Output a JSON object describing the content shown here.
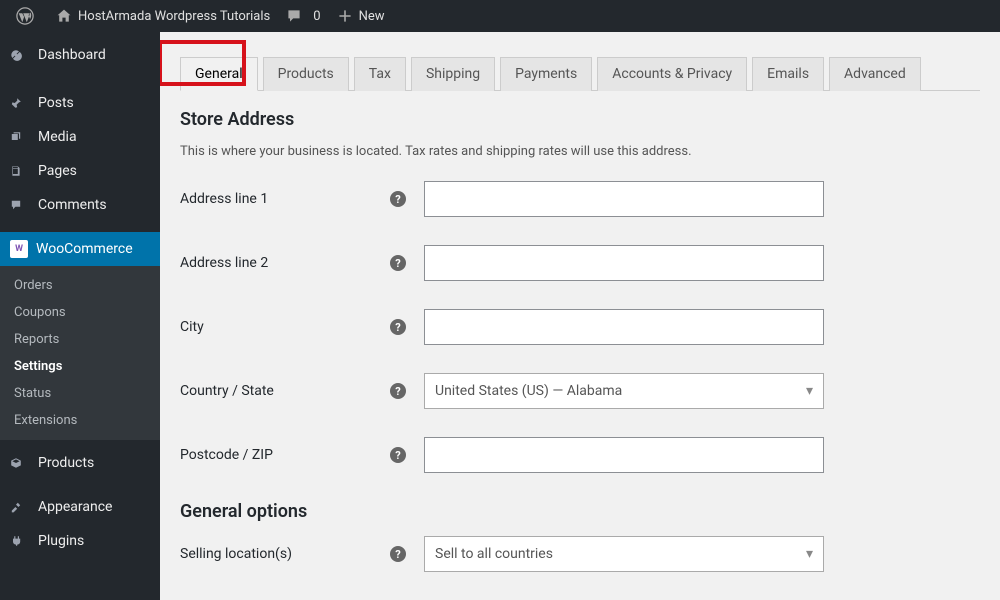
{
  "adminbar": {
    "site_title": "HostArmada Wordpress Tutorials",
    "comments_count": "0",
    "new_label": "New"
  },
  "sidebar": {
    "items": [
      {
        "label": "Dashboard"
      },
      {
        "label": "Posts"
      },
      {
        "label": "Media"
      },
      {
        "label": "Pages"
      },
      {
        "label": "Comments"
      },
      {
        "label": "WooCommerce"
      },
      {
        "label": "Products"
      },
      {
        "label": "Appearance"
      },
      {
        "label": "Plugins"
      }
    ],
    "woo_submenu": [
      {
        "label": "Orders"
      },
      {
        "label": "Coupons"
      },
      {
        "label": "Reports"
      },
      {
        "label": "Settings"
      },
      {
        "label": "Status"
      },
      {
        "label": "Extensions"
      }
    ]
  },
  "tabs": [
    {
      "label": "General"
    },
    {
      "label": "Products"
    },
    {
      "label": "Tax"
    },
    {
      "label": "Shipping"
    },
    {
      "label": "Payments"
    },
    {
      "label": "Accounts & Privacy"
    },
    {
      "label": "Emails"
    },
    {
      "label": "Advanced"
    }
  ],
  "section": {
    "title": "Store Address",
    "description": "This is where your business is located. Tax rates and shipping rates will use this address."
  },
  "fields": {
    "address1": {
      "label": "Address line 1",
      "value": ""
    },
    "address2": {
      "label": "Address line 2",
      "value": ""
    },
    "city": {
      "label": "City",
      "value": ""
    },
    "country": {
      "label": "Country / State",
      "value": "United States (US) — Alabama"
    },
    "postcode": {
      "label": "Postcode / ZIP",
      "value": ""
    }
  },
  "section2": {
    "title": "General options",
    "selling_locations_label": "Selling location(s)",
    "selling_locations_value": "Sell to all countries"
  }
}
